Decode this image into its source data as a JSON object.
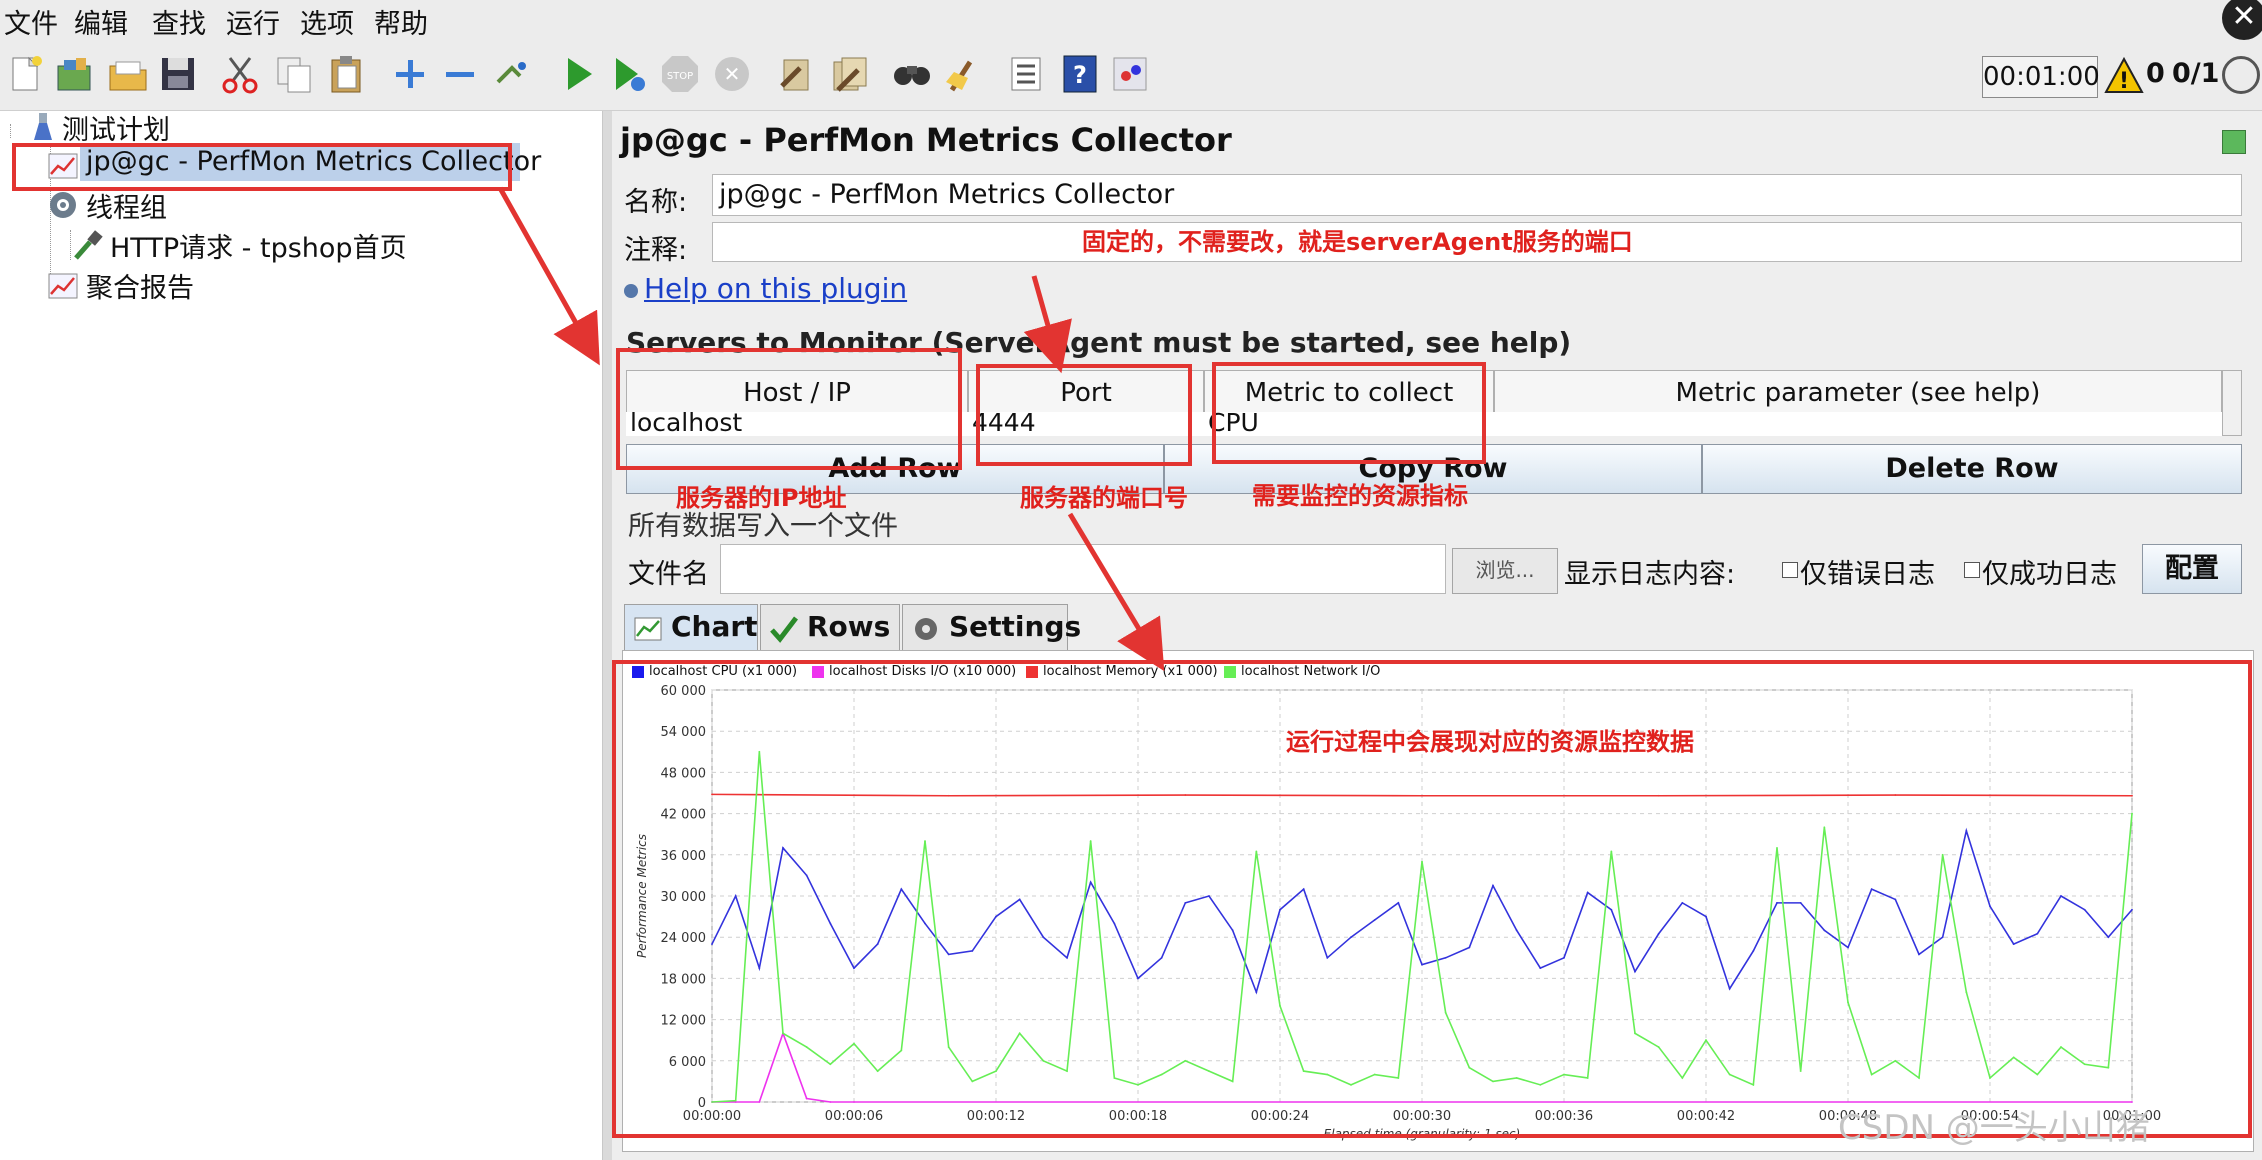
{
  "menu": [
    "文件",
    "编辑",
    "查找",
    "运行",
    "选项",
    "帮助"
  ],
  "toolbar": {
    "icons": [
      "new-icon",
      "templates-icon",
      "open-icon",
      "save-icon",
      "cut-icon",
      "copy-icon",
      "paste-icon",
      "expand-icon",
      "collapse-icon",
      "toggle-icon",
      "start-icon",
      "start-no-pause-icon",
      "stop-icon",
      "shutdown-icon",
      "clear-icon",
      "clear-all-icon",
      "search-icon",
      "reset-search-icon",
      "function-helper-icon",
      "help-icon",
      "remote-icon"
    ],
    "timer": "00:01:00",
    "warning_count": "0",
    "threads": "0/1"
  },
  "tree": {
    "root": "测试计划",
    "items": [
      {
        "label": "jp@gc - PerfMon Metrics Collector",
        "icon": "graph-icon"
      },
      {
        "label": "线程组",
        "icon": "gear-icon"
      },
      {
        "label": "HTTP请求 - tpshop首页",
        "icon": "pipette-icon"
      },
      {
        "label": "聚合报告",
        "icon": "graph-icon"
      }
    ]
  },
  "panel": {
    "title": "jp@gc - PerfMon Metrics Collector",
    "name_label": "名称:",
    "name_value": "jp@gc - PerfMon Metrics Collector",
    "comment_label": "注释:",
    "help_link": "Help on this plugin",
    "section": "Servers to Monitor (ServerAgent must be started, see help)",
    "grid_headers": [
      "Host / IP",
      "Port",
      "Metric to collect",
      "Metric parameter (see help)"
    ],
    "grid_row": [
      "localhost",
      "4444",
      "CPU",
      ""
    ],
    "buttons": [
      "Add Row",
      "Copy Row",
      "Delete Row"
    ],
    "file_section": "所有数据写入一个文件",
    "file_label": "文件名",
    "browse": "浏览...",
    "log_label": "显示日志内容:",
    "errors_only": "仅错误日志",
    "success_only": "仅成功日志",
    "configure": "配置",
    "tabs": [
      "Chart",
      "Rows",
      "Settings"
    ]
  },
  "annotations": {
    "port_note": "固定的，不需要改，就是serverAgent服务的端口",
    "host_note": "服务器的IP地址",
    "port_num_note": "服务器的端口号",
    "metric_note": "需要监控的资源指标",
    "chart_note": "运行过程中会展现对应的资源监控数据"
  },
  "watermark": "CSDN @一头小山猪",
  "chart_data": {
    "type": "line",
    "ylabel": "Performance Metrics",
    "xlabel": "Elapsed time (granularity: 1 sec)",
    "ylim": [
      0,
      60000
    ],
    "yticks": [
      "0",
      "6 000",
      "12 000",
      "18 000",
      "24 000",
      "30 000",
      "36 000",
      "42 000",
      "48 000",
      "54 000",
      "60 000"
    ],
    "xticks": [
      "00:00:00",
      "00:00:06",
      "00:00:12",
      "00:00:18",
      "00:00:24",
      "00:00:30",
      "00:00:36",
      "00:00:42",
      "00:00:48",
      "00:00:54",
      "00:01:00"
    ],
    "xmax": 60,
    "grid": true,
    "legend_position": "top-left",
    "series": [
      {
        "name": "localhost CPU (x1 000)",
        "color": "#3333dd",
        "x": [
          0,
          1,
          2,
          3,
          4,
          5,
          6,
          7,
          8,
          9,
          10,
          11,
          12,
          13,
          14,
          15,
          16,
          17,
          18,
          19,
          20,
          21,
          22,
          23,
          24,
          25,
          26,
          27,
          28,
          29,
          30,
          31,
          32,
          33,
          34,
          35,
          36,
          37,
          38,
          39,
          40,
          41,
          42,
          43,
          44,
          45,
          46,
          47,
          48,
          49,
          50,
          51,
          52,
          53,
          54,
          55,
          56,
          57,
          58,
          59,
          60
        ],
        "y": [
          23000,
          30000,
          19500,
          37000,
          33000,
          26000,
          19500,
          23000,
          31000,
          26000,
          21500,
          22000,
          27000,
          29500,
          24000,
          21000,
          32000,
          26000,
          18000,
          21000,
          29000,
          30000,
          25000,
          16000,
          28000,
          31000,
          21000,
          24000,
          26500,
          29000,
          20000,
          21000,
          22500,
          31500,
          25000,
          19500,
          21000,
          30500,
          28000,
          19000,
          24500,
          29000,
          27000,
          16500,
          22000,
          29000,
          29000,
          25000,
          22500,
          31000,
          29500,
          21500,
          24000,
          39500,
          28500,
          23000,
          24500,
          30000,
          28000,
          24000,
          28000
        ]
      },
      {
        "name": "localhost Disks I/O (x10 000)",
        "color": "#ee33ee",
        "x": [
          0,
          1,
          2,
          3,
          4,
          5,
          6,
          60
        ],
        "y": [
          0,
          0,
          0,
          10000,
          500,
          0,
          0,
          0
        ]
      },
      {
        "name": "localhost Memory (x1 000)",
        "color": "#ee3333",
        "x": [
          0,
          10,
          20,
          30,
          40,
          50,
          60
        ],
        "y": [
          44800,
          44600,
          44700,
          44600,
          44600,
          44700,
          44600
        ]
      },
      {
        "name": "localhost Network I/O",
        "color": "#66ee55",
        "x": [
          0,
          1,
          2,
          3,
          4,
          5,
          6,
          7,
          8,
          9,
          10,
          11,
          12,
          13,
          14,
          15,
          16,
          17,
          18,
          19,
          20,
          21,
          22,
          23,
          24,
          25,
          26,
          27,
          28,
          29,
          30,
          31,
          32,
          33,
          34,
          35,
          36,
          37,
          38,
          39,
          40,
          41,
          42,
          43,
          44,
          45,
          46,
          47,
          48,
          49,
          50,
          51,
          52,
          53,
          54,
          55,
          56,
          57,
          58,
          59,
          60
        ],
        "y": [
          0,
          200,
          51000,
          10000,
          8000,
          5500,
          8500,
          4500,
          7500,
          38000,
          8000,
          3000,
          4500,
          10000,
          6000,
          4500,
          38000,
          3500,
          2500,
          4000,
          6000,
          4500,
          3000,
          36500,
          14000,
          4500,
          4000,
          2500,
          4000,
          3500,
          35000,
          13000,
          5000,
          3000,
          3500,
          2500,
          4000,
          3500,
          36500,
          10000,
          8000,
          3500,
          9000,
          4000,
          2500,
          37000,
          4500,
          40000,
          14500,
          4000,
          6000,
          3500,
          36000,
          16000,
          3500,
          6500,
          4000,
          8000,
          5500,
          5000,
          42000
        ]
      }
    ]
  }
}
